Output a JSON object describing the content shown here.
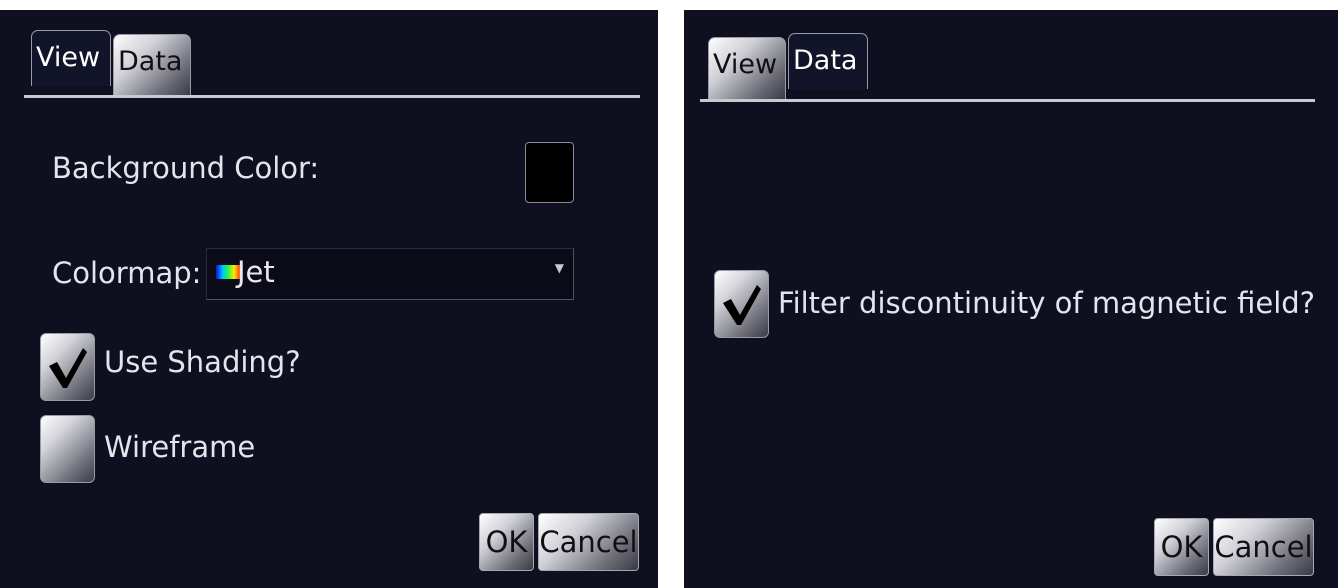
{
  "left_dialog": {
    "tabs": [
      {
        "label": "View",
        "active": true
      },
      {
        "label": "Data",
        "active": false
      }
    ],
    "background_color_label": "Background Color:",
    "background_color_value": "#000000",
    "colormap_label": "Colormap:",
    "colormap_value": "Jet",
    "shading_label": "Use Shading?",
    "shading_checked": true,
    "wireframe_label": "Wireframe",
    "wireframe_checked": false,
    "ok_label": "OK",
    "cancel_label": "Cancel"
  },
  "right_dialog": {
    "tabs": [
      {
        "label": "View",
        "active": false
      },
      {
        "label": "Data",
        "active": true
      }
    ],
    "filter_label": "Filter discontinuity of magnetic field?",
    "filter_checked": true,
    "ok_label": "OK",
    "cancel_label": "Cancel"
  },
  "colors": {
    "dialog_bg": "#0e1020",
    "text": "#e4e4ea",
    "checkmark": "#000000"
  }
}
